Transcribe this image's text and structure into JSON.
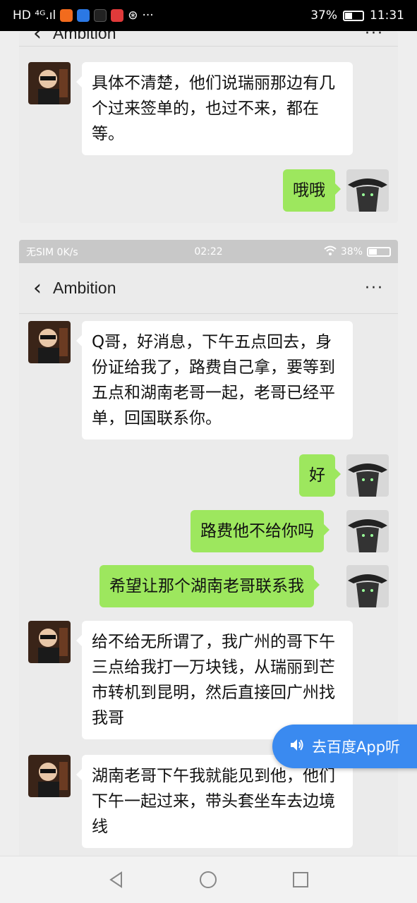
{
  "phone_status": {
    "left_text": "HD ⁴ᴳ.ıl",
    "battery": "37%",
    "time": "11:31",
    "app_icons": [
      {
        "name": "sohu-icon",
        "color": "#f26b1d"
      },
      {
        "name": "baidu-icon",
        "color": "#2b78e4"
      },
      {
        "name": "tiktok-icon",
        "color": "#111111"
      },
      {
        "name": "toutiao-icon",
        "color": "#e03a3a"
      }
    ],
    "more": "···"
  },
  "top_chat": {
    "title": "Ambition",
    "messages": [
      {
        "side": "left",
        "text": "具体不清楚，他们说瑞丽那边有几个过来签单的，也过不来，都在等。"
      },
      {
        "side": "right",
        "text": "哦哦"
      }
    ]
  },
  "inner_status": {
    "left": "无SIM 0K/s",
    "time": "02:22",
    "battery": "38%"
  },
  "chat": {
    "title": "Ambition",
    "back_icon": "chevron-left-icon",
    "more": "···",
    "messages": [
      {
        "side": "left",
        "text": "Q哥，好消息，下午五点回去，身份证给我了，路费自己拿，要等到五点和湖南老哥一起，老哥已经平单，回国联系你。"
      },
      {
        "side": "right",
        "text": "好"
      },
      {
        "side": "right",
        "text": "路费他不给你吗"
      },
      {
        "side": "right",
        "text": "希望让那个湖南老哥联系我"
      },
      {
        "side": "left",
        "text": "给不给无所谓了，我广州的哥下午三点给我打一万块钱，从瑞丽到芒市转机到昆明，然后直接回广州找我哥"
      },
      {
        "side": "left",
        "text": "湖南老哥下午我就能见到他，他们下午一起过来，带头套坐车去边境线"
      }
    ]
  },
  "listen_button": {
    "label": "去百度App听",
    "icon": "speaker-icon"
  },
  "navbar": {
    "back": "triangle-back-icon",
    "home": "circle-home-icon",
    "recents": "square-recents-icon"
  }
}
